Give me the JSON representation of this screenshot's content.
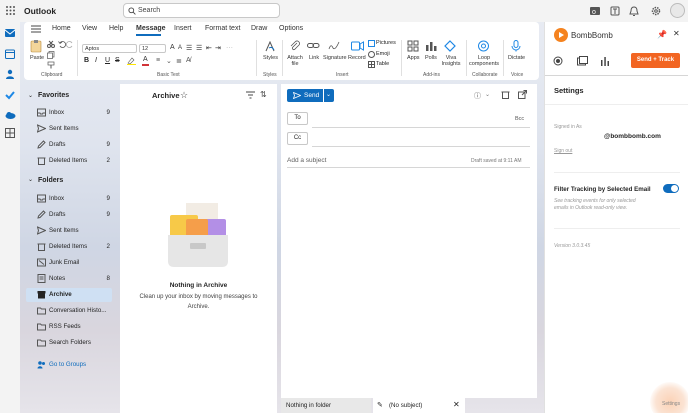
{
  "titlebar": {
    "app": "Outlook",
    "search_placeholder": "Search"
  },
  "ribbon": {
    "tabs": [
      "Home",
      "View",
      "Help",
      "Message",
      "Insert",
      "Format text",
      "Draw",
      "Options"
    ],
    "active_tab": "Message",
    "clipboard": {
      "paste": "Paste",
      "group": "Clipboard"
    },
    "basic_text": {
      "font": "Aptos",
      "size": "12",
      "group": "Basic Text"
    },
    "styles": {
      "label": "Styles",
      "group": "Styles"
    },
    "insert": {
      "attach": "Attach file",
      "link": "Link",
      "signature": "Signature",
      "record": "Record",
      "pictures": "Pictures",
      "emoji": "Emoji",
      "table": "Table",
      "group": "Insert"
    },
    "addins": {
      "apps": "Apps",
      "polls": "Polls",
      "viva": "Viva Insights",
      "group": "Add-ins"
    },
    "collaborate": {
      "loop": "Loop components",
      "group": "Collaborate"
    },
    "voice": {
      "dictate": "Dictate",
      "group": "Voice"
    }
  },
  "folders": {
    "favorites_label": "Favorites",
    "favorites": [
      {
        "name": "Inbox",
        "count": "9"
      },
      {
        "name": "Sent Items",
        "count": ""
      },
      {
        "name": "Drafts",
        "count": "9"
      },
      {
        "name": "Deleted Items",
        "count": "2"
      }
    ],
    "folders_label": "Folders",
    "list": [
      {
        "name": "Inbox",
        "count": "9"
      },
      {
        "name": "Drafts",
        "count": "9"
      },
      {
        "name": "Sent Items",
        "count": ""
      },
      {
        "name": "Deleted Items",
        "count": "2"
      },
      {
        "name": "Junk Email",
        "count": ""
      },
      {
        "name": "Notes",
        "count": "8"
      },
      {
        "name": "Archive",
        "count": ""
      },
      {
        "name": "Conversation Histo...",
        "count": ""
      },
      {
        "name": "RSS Feeds",
        "count": ""
      },
      {
        "name": "Search Folders",
        "count": ""
      }
    ],
    "goto_groups": "Go to Groups"
  },
  "message_list": {
    "title": "Archive",
    "empty_title": "Nothing in Archive",
    "empty_desc": "Clean up your inbox by moving messages to Archive."
  },
  "compose": {
    "send": "Send",
    "to": "To",
    "cc": "Cc",
    "bcc": "Bcc",
    "subject_placeholder": "Add a subject",
    "draft_saved": "Draft saved at 9:11 AM"
  },
  "bottom_tabs": {
    "tab1": "Nothing in folder",
    "tab2": "(No subject)"
  },
  "bombbomb": {
    "name": "BombBomb",
    "send_track": "Send + Track",
    "settings_title": "Settings",
    "signed_in_as": "Signed in As",
    "email": "@bombbomb.com",
    "sign_out": "Sign out",
    "filter_label": "Filter Tracking by Selected Email",
    "filter_desc": "See tracking events for only selected emails in Outlook read-only view.",
    "version": "Version 3.0.3.45",
    "footer_settings": "Settings"
  },
  "colors": {
    "accent": "#0f6cbd",
    "bombbomb_orange": "#f26522",
    "selected_folder": "#cfe0f3"
  }
}
